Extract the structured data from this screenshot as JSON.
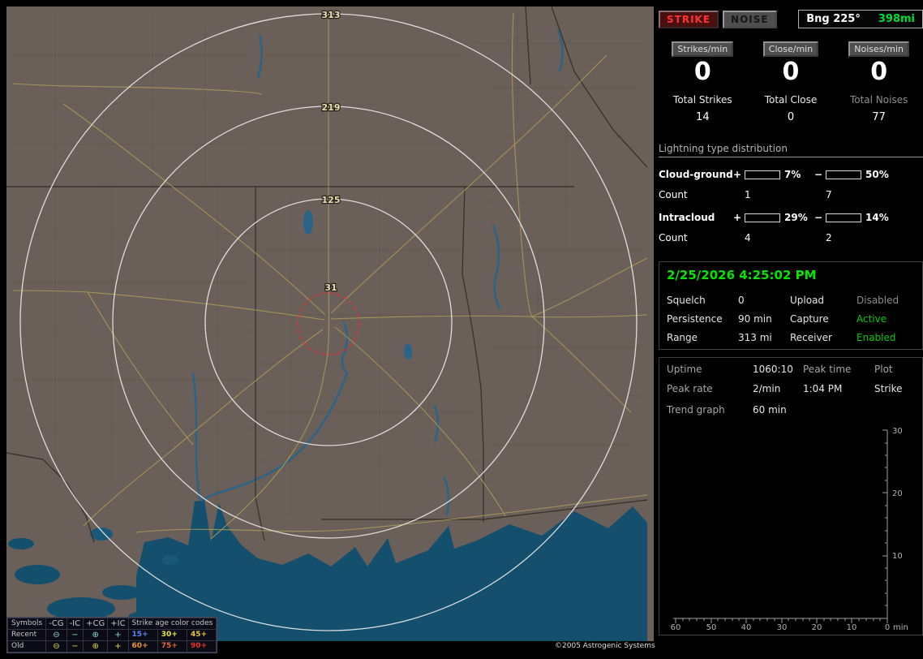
{
  "colors": {
    "accent_green": "#00dd33",
    "strike_red": "#ff3232",
    "cg_plus_bar": "#e01212",
    "cg_minus_bar": "#7fb2e8",
    "ic_plus_bar": "#f070b8",
    "ic_minus_bar": "#28d828"
  },
  "map": {
    "range_labels": [
      "313",
      "219",
      "125",
      "31"
    ],
    "copyright": "©2005 Astrogenic Systems",
    "legend": {
      "header_symbols": "Symbols",
      "header_cols": [
        "-CG",
        "-IC",
        "+CG",
        "+IC"
      ],
      "header_age": "Strike age color codes",
      "rows": [
        {
          "label": "Recent",
          "symbols": [
            "⊖",
            "−",
            "⊕",
            "+"
          ],
          "ages": [
            {
              "text": "15+",
              "color": "#5588ff"
            },
            {
              "text": "30+",
              "color": "#e8e84a"
            },
            {
              "text": "45+",
              "color": "#e8c244"
            }
          ]
        },
        {
          "label": "Old",
          "symbols": [
            "⊖",
            "−",
            "⊕",
            "+"
          ],
          "ages": [
            {
              "text": "60+",
              "color": "#ee9933"
            },
            {
              "text": "75+",
              "color": "#ee6633"
            },
            {
              "text": "90+",
              "color": "#ee3322"
            }
          ]
        }
      ]
    }
  },
  "panel": {
    "strike_button": "STRIKE",
    "noise_button": "NOISE",
    "bearing": "Bng 225°",
    "bearing_range": "398mi",
    "rate_columns": [
      {
        "button": "Strikes/min",
        "rate": "0",
        "total_label": "Total Strikes",
        "total_value": "14"
      },
      {
        "button": "Close/min",
        "rate": "0",
        "total_label": "Total Close",
        "total_value": "0"
      },
      {
        "button": "Noises/min",
        "rate": "0",
        "total_label": "Total Noises",
        "total_value": "77"
      }
    ],
    "distribution": {
      "title": "Lightning type distribution",
      "count_label": "Count",
      "rows": [
        {
          "label": "Cloud-ground",
          "plus_sign": "+",
          "minus_sign": "−",
          "plus_pct": "7%",
          "plus_pct_num": 7,
          "minus_pct": "50%",
          "minus_pct_num": 50,
          "plus_count": "1",
          "minus_count": "7"
        },
        {
          "label": "Intracloud",
          "plus_sign": "+",
          "minus_sign": "−",
          "plus_pct": "29%",
          "plus_pct_num": 29,
          "minus_pct": "14%",
          "minus_pct_num": 14,
          "plus_count": "4",
          "minus_count": "2"
        }
      ]
    },
    "clock": "2/25/2026 4:25:02 PM",
    "status_rows": [
      {
        "label1": "Squelch",
        "value1": "0",
        "label2": "Upload",
        "value2": "Disabled"
      },
      {
        "label1": "Persistence",
        "value1": "90 min",
        "label2": "Capture",
        "value2": "Active"
      },
      {
        "label1": "Range",
        "value1": "313 mi",
        "label2": "Receiver",
        "value2": "Enabled"
      }
    ],
    "stats": {
      "uptime_label": "Uptime",
      "uptime": "1060:10",
      "peak_time_label": "Peak time",
      "plot_label": "Plot",
      "peak_rate_label": "Peak rate",
      "peak_rate": "2/min",
      "peak_time": "1:04 PM",
      "plot_value": "Strike",
      "trend_label": "Trend graph",
      "trend_value": "60 min"
    },
    "trend": {
      "y_ticks": [
        "30",
        "20",
        "10"
      ],
      "x_ticks": [
        "60",
        "50",
        "40",
        "30",
        "20",
        "10",
        "0"
      ],
      "x_unit": "min"
    }
  }
}
